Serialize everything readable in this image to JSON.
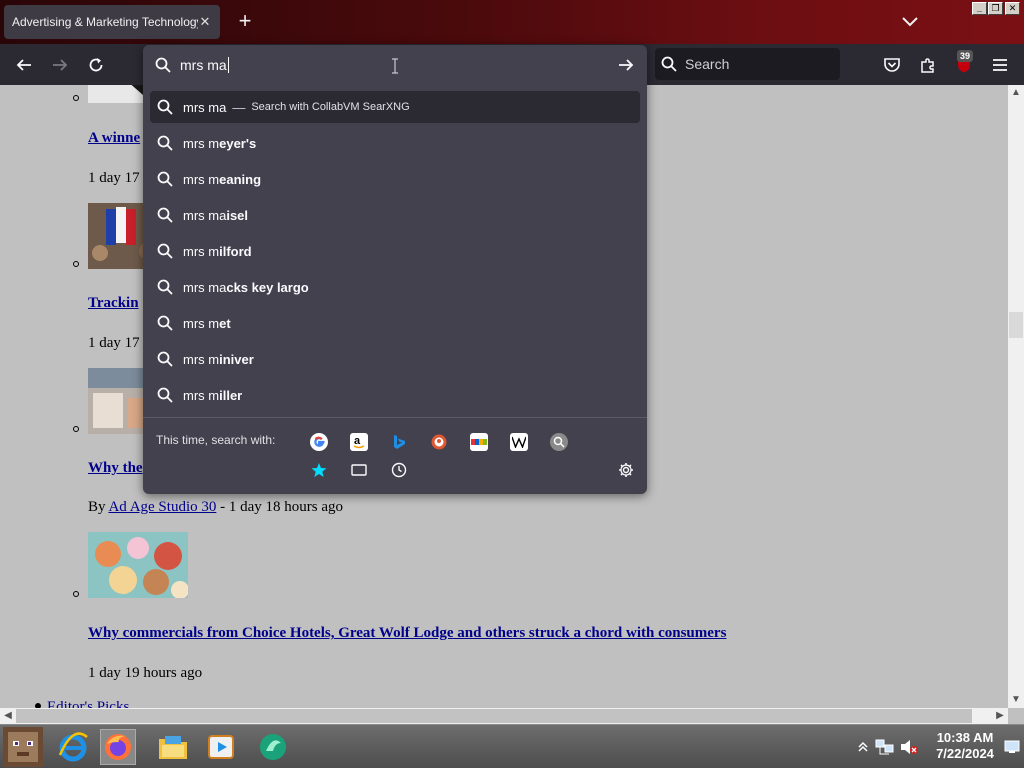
{
  "tab": {
    "title": "Advertising & Marketing Technology Ne",
    "close_glyph": "✕"
  },
  "newtab_glyph": "+",
  "window_controls": {
    "minimize": "_",
    "restore": "❐",
    "close": "✕"
  },
  "navbar": {
    "search_placeholder": "Search",
    "extension_badge": "39"
  },
  "urlbar": {
    "typed": "mrs ma",
    "suggestions": [
      {
        "typed": "mrs ma",
        "rest": "",
        "action": "Search with CollabVM SearXNG",
        "active": true
      },
      {
        "typed": "mrs m",
        "rest": "eyer's"
      },
      {
        "typed": "mrs m",
        "rest": "eaning"
      },
      {
        "typed": "mrs ma",
        "rest": "isel"
      },
      {
        "typed": "mrs m",
        "rest": "ilford"
      },
      {
        "typed": "mrs ma",
        "rest": "cks key largo"
      },
      {
        "typed": "mrs m",
        "rest": "et"
      },
      {
        "typed": "mrs m",
        "rest": "iniver"
      },
      {
        "typed": "mrs m",
        "rest": "iller"
      }
    ],
    "oneoff_label": "This time, search with:",
    "engines": [
      "google",
      "amazon",
      "bing",
      "duckduckgo",
      "ebay",
      "wikipedia",
      "searxng"
    ],
    "dash": "—"
  },
  "page": {
    "articles": [
      {
        "title": "A winne",
        "meta": "1 day 17"
      },
      {
        "title": "Trackin",
        "meta": "1 day 17"
      },
      {
        "title": "Why the",
        "meta_prefix": "By ",
        "meta_link": "Ad Age Studio 30",
        "meta_suffix": " - 1 day 18 hours ago"
      },
      {
        "title": "Why commercials from Choice Hotels, Great Wolf Lodge and others struck a chord with consumers",
        "meta": "1 day 19 hours ago"
      }
    ],
    "footer_link": "Editor's Picks"
  },
  "taskbar": {
    "time": "10:38 AM",
    "date": "7/22/2024"
  },
  "colors": {
    "tab_active": "#3f3b45",
    "toolbar": "#2b2a33",
    "dropdown": "#42414d",
    "page_bg": "#c0c0c0",
    "link": "#00008b",
    "taskbar": "#5a5a5a"
  }
}
